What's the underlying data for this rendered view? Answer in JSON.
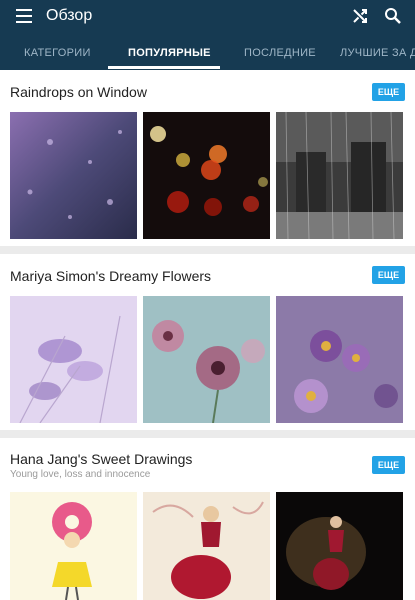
{
  "header": {
    "title": "Обзор",
    "icons": [
      "menu-icon",
      "shuffle-icon",
      "search-icon"
    ]
  },
  "tabs": [
    {
      "label": "КАТЕГОРИИ",
      "active": false
    },
    {
      "label": "ПОПУЛЯРНЫЕ",
      "active": true
    },
    {
      "label": "ПОСЛЕДНИЕ",
      "active": false
    },
    {
      "label": "ЛУЧШИЕ ЗА ДЕНЬ",
      "active": false
    }
  ],
  "collections": [
    {
      "title": "Raindrops on Window",
      "subtitle": "",
      "more_label": "ЕЩЕ"
    },
    {
      "title": "Mariya Simon's Dreamy Flowers",
      "subtitle": "",
      "more_label": "ЕЩЕ"
    },
    {
      "title": "Hana Jang's Sweet Drawings",
      "subtitle": "Young love, loss and innocence",
      "more_label": "ЕЩЕ"
    }
  ],
  "colors": {
    "appbar": "#163a52",
    "accent": "#22a2e6",
    "tab_inactive": "#9fb6c7"
  }
}
